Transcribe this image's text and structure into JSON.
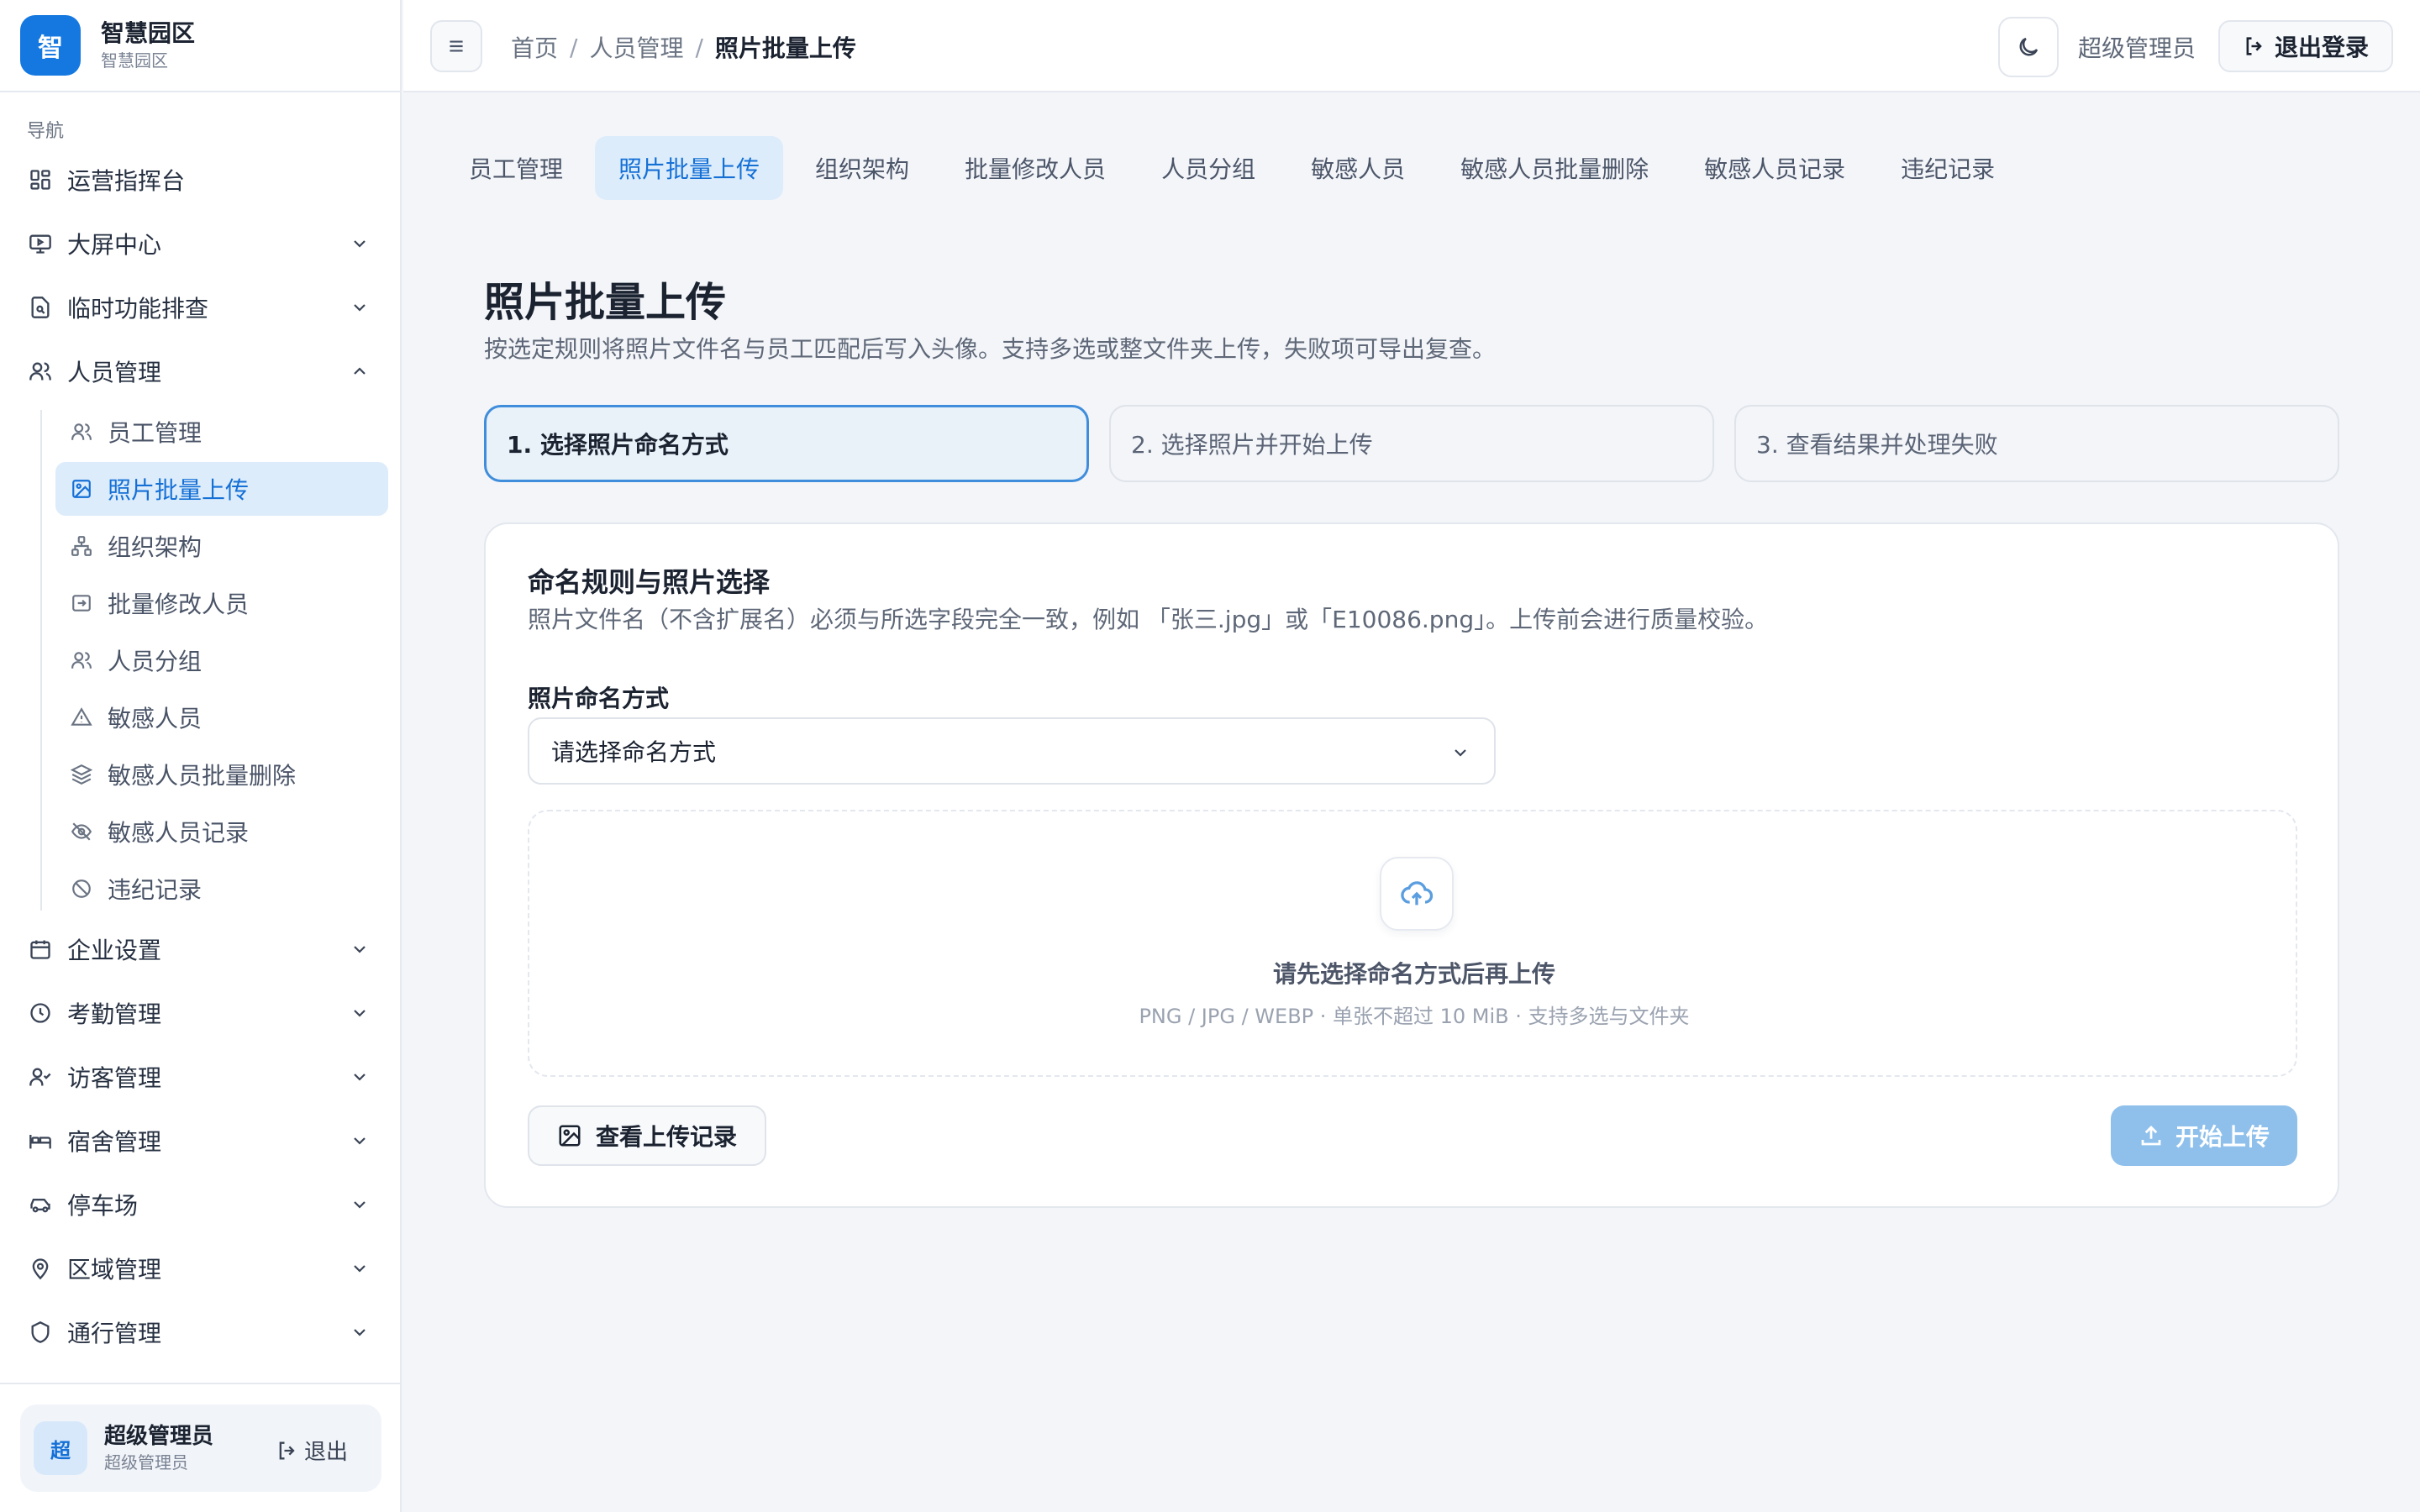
{
  "brand": {
    "logo_char": "智",
    "title": "智慧园区",
    "subtitle": "智慧园区"
  },
  "sidebar": {
    "caption": "导航",
    "items": [
      {
        "label": "运营指挥台",
        "icon": "dashboard-icon"
      },
      {
        "label": "大屏中心",
        "icon": "monitor-icon"
      },
      {
        "label": "临时功能排查",
        "icon": "file-search-icon"
      },
      {
        "label": "人员管理",
        "icon": "users-icon"
      },
      {
        "label": "企业设置",
        "icon": "calendar-icon"
      },
      {
        "label": "考勤管理",
        "icon": "clock-icon"
      },
      {
        "label": "访客管理",
        "icon": "user-check-icon"
      },
      {
        "label": "宿舍管理",
        "icon": "bed-icon"
      },
      {
        "label": "停车场",
        "icon": "car-icon"
      },
      {
        "label": "区域管理",
        "icon": "map-pin-icon"
      },
      {
        "label": "通行管理",
        "icon": "shield-icon"
      }
    ],
    "sub_items": [
      {
        "label": "员工管理",
        "icon": "users-icon"
      },
      {
        "label": "照片批量上传",
        "icon": "image-upload-icon"
      },
      {
        "label": "组织架构",
        "icon": "org-chart-icon"
      },
      {
        "label": "批量修改人员",
        "icon": "user-edit-icon"
      },
      {
        "label": "人员分组",
        "icon": "group-icon"
      },
      {
        "label": "敏感人员",
        "icon": "warning-icon"
      },
      {
        "label": "敏感人员批量删除",
        "icon": "layers-icon"
      },
      {
        "label": "敏感人员记录",
        "icon": "eye-off-icon"
      },
      {
        "label": "违纪记录",
        "icon": "ban-icon"
      }
    ],
    "user": {
      "avatar_char": "超",
      "name": "超级管理员",
      "role": "超级管理员",
      "logout_label": "退出"
    }
  },
  "header": {
    "breadcrumb": [
      "首页",
      "人员管理",
      "照片批量上传"
    ],
    "user_label": "超级管理员",
    "logout_label": "退出登录"
  },
  "tabs": [
    "员工管理",
    "照片批量上传",
    "组织架构",
    "批量修改人员",
    "人员分组",
    "敏感人员",
    "敏感人员批量删除",
    "敏感人员记录",
    "违纪记录"
  ],
  "main": {
    "title": "照片批量上传",
    "description": "按选定规则将照片文件名与员工匹配后写入头像。支持多选或整文件夹上传，失败项可导出复查。",
    "steps": [
      "1. 选择照片命名方式",
      "2. 选择照片并开始上传",
      "3. 查看结果并处理失败"
    ],
    "card": {
      "title": "命名规则与照片选择",
      "description": "照片文件名（不含扩展名）必须与所选字段完全一致，例如 「张三.jpg」或「E10086.png」。上传前会进行质量校验。",
      "field_label": "照片命名方式",
      "select_placeholder": "请选择命名方式",
      "dropzone_title": "请先选择命名方式后再上传",
      "dropzone_hint": "PNG / JPG / WEBP · 单张不超过 10 MiB · 支持多选与文件夹",
      "records_button": "查看上传记录",
      "upload_button": "开始上传"
    }
  },
  "colors": {
    "accent": "#1578e0",
    "active_bg": "#dcecfb",
    "active_text": "#1570d6",
    "upload_disabled": "#8fc0ec"
  }
}
